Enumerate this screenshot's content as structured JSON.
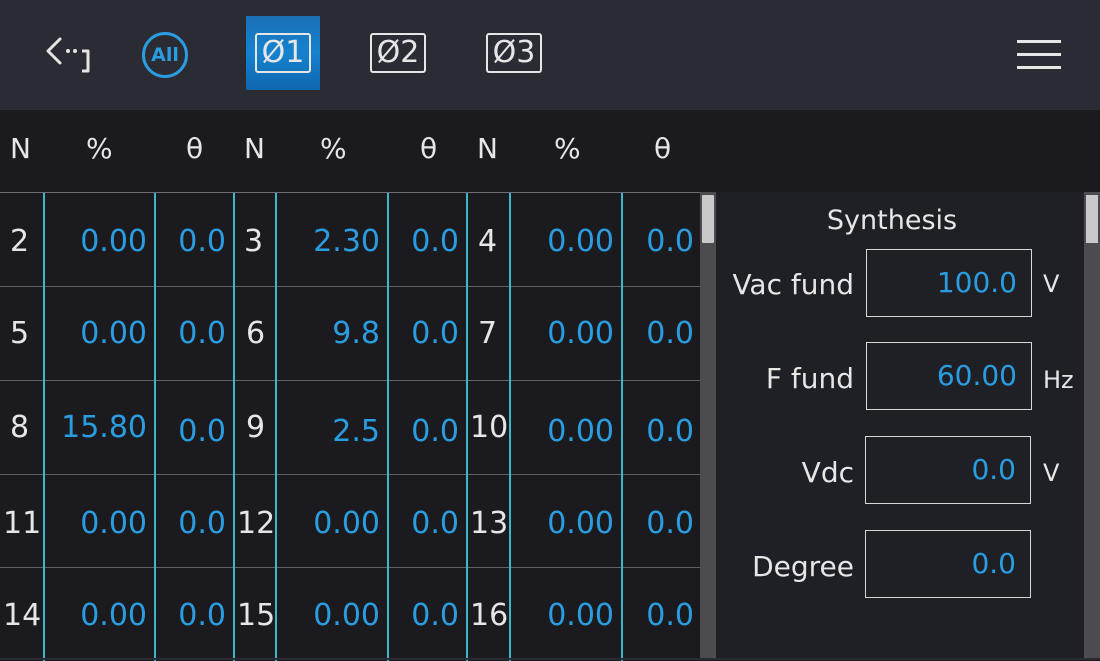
{
  "toolbar": {
    "all_label": "All",
    "phases": [
      {
        "label": "Ø1",
        "active": true
      },
      {
        "label": "Ø2",
        "active": false
      },
      {
        "label": "Ø3",
        "active": false
      }
    ],
    "back_icon": "back-arrow-icon",
    "menu_icon": "hamburger-menu-icon"
  },
  "table": {
    "headers": [
      "N",
      "%",
      "θ",
      "N",
      "%",
      "θ",
      "N",
      "%",
      "θ"
    ],
    "rows": [
      [
        {
          "n": "2",
          "pct": "0.00",
          "theta": "0.0"
        },
        {
          "n": "3",
          "pct": "2.30",
          "theta": "0.0"
        },
        {
          "n": "4",
          "pct": "0.00",
          "theta": "0.0"
        }
      ],
      [
        {
          "n": "5",
          "pct": "0.00",
          "theta": "0.0"
        },
        {
          "n": "6",
          "pct": "9.8",
          "theta": "0.0"
        },
        {
          "n": "7",
          "pct": "0.00",
          "theta": "0.0"
        }
      ],
      [
        {
          "n": "8",
          "pct": "15.80",
          "theta": "0.0"
        },
        {
          "n": "9",
          "pct": "2.5",
          "theta": "0.0"
        },
        {
          "n": "10",
          "pct": "0.00",
          "theta": "0.0"
        }
      ],
      [
        {
          "n": "11",
          "pct": "0.00",
          "theta": "0.0"
        },
        {
          "n": "12",
          "pct": "0.00",
          "theta": "0.0"
        },
        {
          "n": "13",
          "pct": "0.00",
          "theta": "0.0"
        }
      ],
      [
        {
          "n": "14",
          "pct": "0.00",
          "theta": "0.0"
        },
        {
          "n": "15",
          "pct": "0.00",
          "theta": "0.0"
        },
        {
          "n": "16",
          "pct": "0.00",
          "theta": "0.0"
        }
      ]
    ]
  },
  "synthesis": {
    "title": "Synthesis",
    "fields": [
      {
        "label": "Vac fund",
        "value": "100.0",
        "unit": "V"
      },
      {
        "label": "F fund",
        "value": "60.00",
        "unit": "Hz"
      },
      {
        "label": "Vdc",
        "value": "0.0",
        "unit": "V"
      },
      {
        "label": "Degree",
        "value": "0.0",
        "unit": ""
      }
    ]
  },
  "colors": {
    "value_blue": "#2a9de0",
    "grid_cyan": "#3fb5c8",
    "active_tab_blue": "#1582cf",
    "background": "#1b1b1f",
    "toolbar_bg": "#2a2b33"
  }
}
